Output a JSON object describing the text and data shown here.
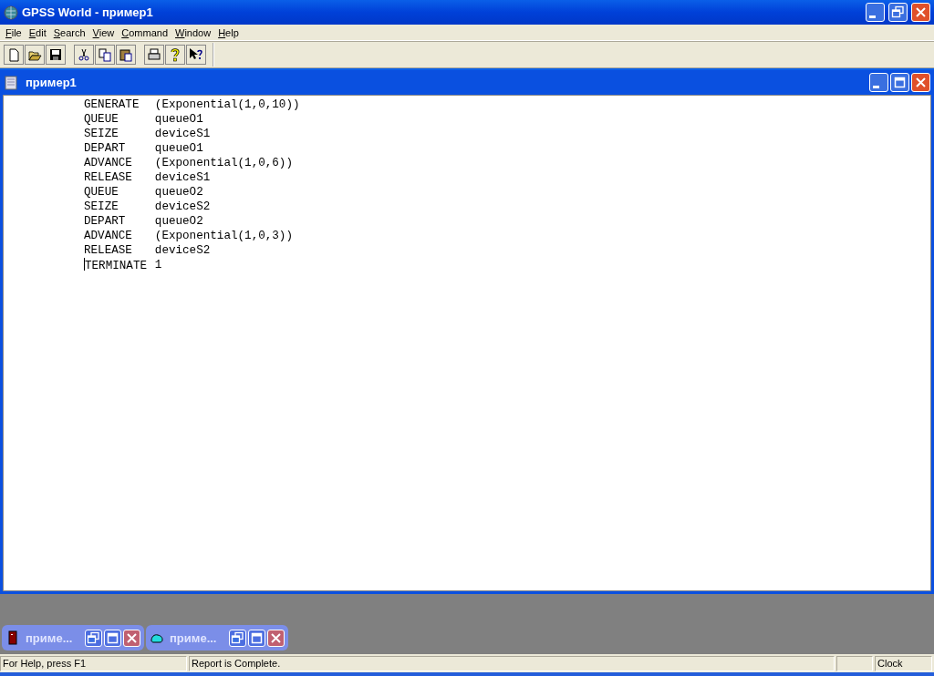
{
  "window": {
    "title": "GPSS World - пример1"
  },
  "menu": [
    "File",
    "Edit",
    "Search",
    "View",
    "Command",
    "Window",
    "Help"
  ],
  "toolbar": [
    {
      "kind": "new"
    },
    {
      "kind": "open"
    },
    {
      "kind": "save"
    },
    {
      "kind": "sep"
    },
    {
      "kind": "cut"
    },
    {
      "kind": "copy"
    },
    {
      "kind": "paste"
    },
    {
      "kind": "sep"
    },
    {
      "kind": "print"
    },
    {
      "kind": "help"
    },
    {
      "kind": "context-help"
    }
  ],
  "document": {
    "title": "пример1",
    "lines": [
      {
        "opcode": "GENERATE",
        "operand": "(Exponential(1,0,10))"
      },
      {
        "opcode": "QUEUE",
        "operand": "queueO1"
      },
      {
        "opcode": "SEIZE",
        "operand": "deviceS1"
      },
      {
        "opcode": "DEPART",
        "operand": "queueO1"
      },
      {
        "opcode": "ADVANCE",
        "operand": "(Exponential(1,0,6))"
      },
      {
        "opcode": "RELEASE",
        "operand": "deviceS1"
      },
      {
        "opcode": "QUEUE",
        "operand": "queueO2"
      },
      {
        "opcode": "SEIZE",
        "operand": "deviceS2"
      },
      {
        "opcode": "DEPART",
        "operand": "queueO2"
      },
      {
        "opcode": "ADVANCE",
        "operand": "(Exponential(1,0,3))"
      },
      {
        "opcode": "RELEASE",
        "operand": "deviceS2"
      },
      {
        "opcode": "TERMINATE",
        "operand": "1"
      }
    ]
  },
  "minimized_windows": [
    {
      "title": "приме...",
      "kind": "report"
    },
    {
      "title": "приме...",
      "kind": "journal"
    }
  ],
  "status_bar": {
    "help": "For Help, press F1",
    "message": "Report is Complete.",
    "clock": "Clock"
  }
}
